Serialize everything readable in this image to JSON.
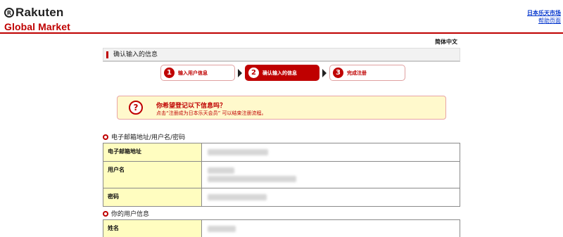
{
  "header": {
    "logo_top": "Rakuten",
    "logo_sub": "Global Market",
    "links": [
      "日本乐天市场",
      "帮助页面"
    ],
    "accent": "#bf0000"
  },
  "language": "简体中文",
  "page_title": "确认输入的信息",
  "steps": [
    {
      "num": "1",
      "label": "输入用户信息"
    },
    {
      "num": "2",
      "label": "确认输入的信息"
    },
    {
      "num": "3",
      "label": "完成注册"
    }
  ],
  "confirm": {
    "icon": "question-icon",
    "question": "你希望登记以下信息吗？",
    "note": "点击“注册成为日本乐天会员” 可以结束注册流程。"
  },
  "sections": [
    {
      "title": "电子邮箱地址/用户名/密码",
      "rows": [
        {
          "label": "电子邮箱地址"
        },
        {
          "label": "用户名"
        },
        {
          "label": "密码"
        }
      ]
    },
    {
      "title": "你的用户信息",
      "rows": [
        {
          "label": "姓名"
        }
      ]
    }
  ]
}
